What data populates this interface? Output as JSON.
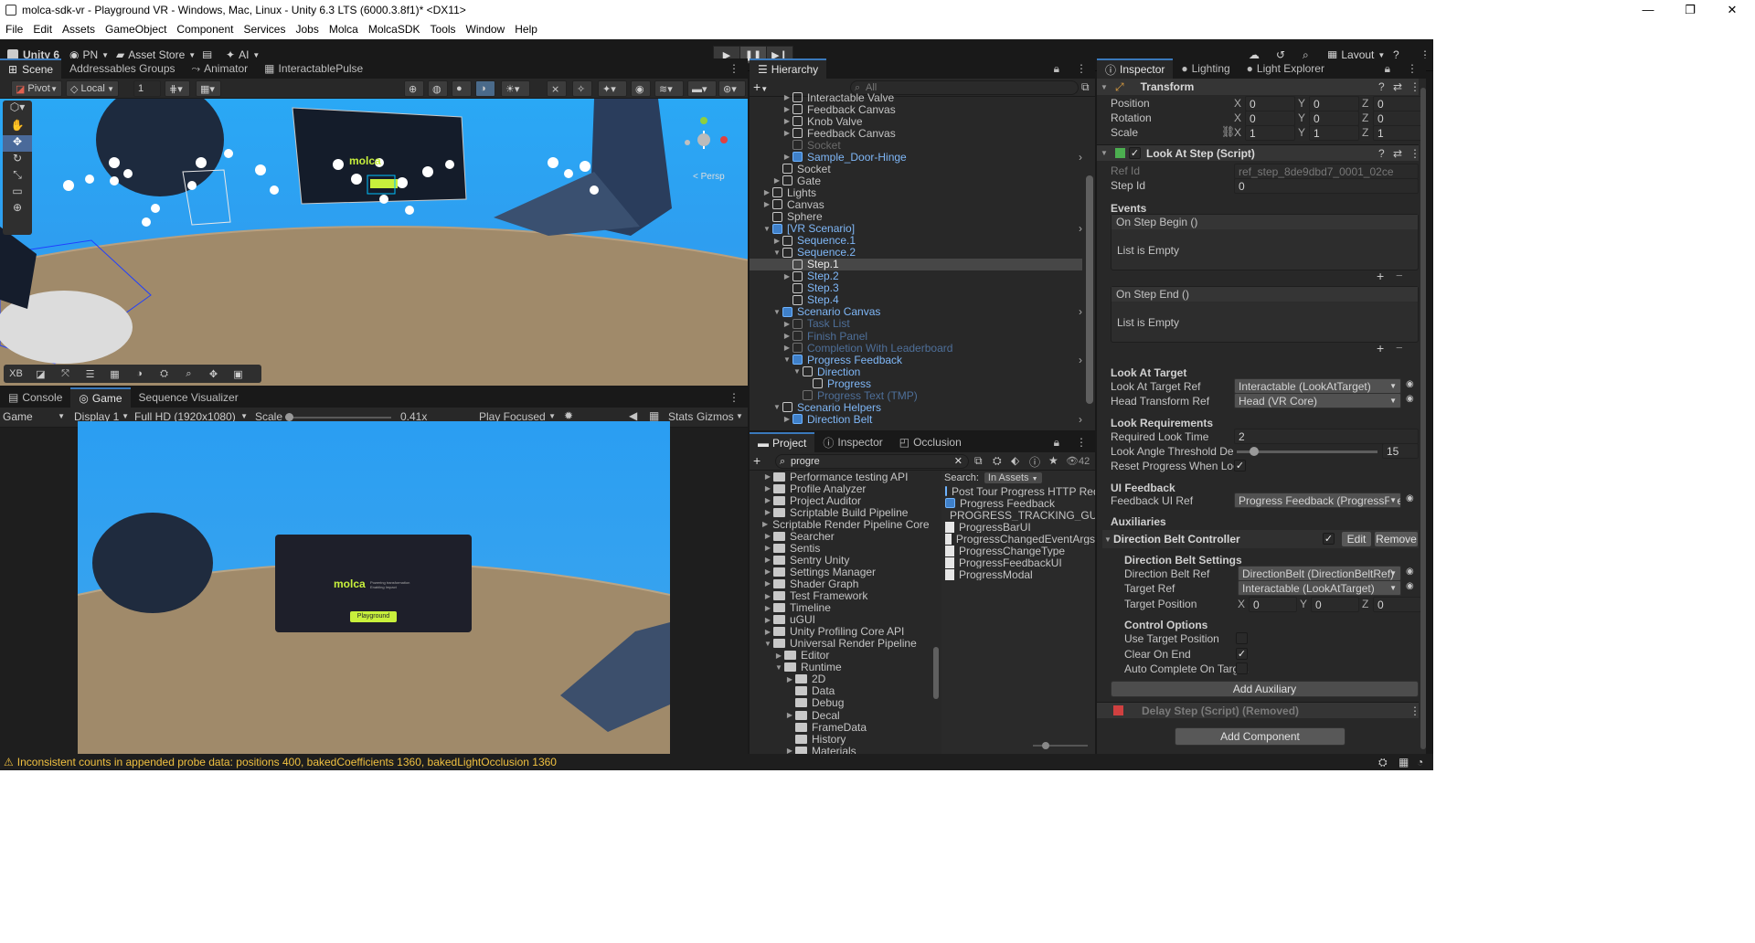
{
  "window": {
    "title": "molca-sdk-vr - Playground VR - Windows, Mac, Linux - Unity 6.3 LTS (6000.3.8f1)* <DX11>"
  },
  "menu": [
    "File",
    "Edit",
    "Assets",
    "GameObject",
    "Component",
    "Services",
    "Jobs",
    "Molca",
    "MolcaSDK",
    "Tools",
    "Window",
    "Help"
  ],
  "toolbar": {
    "unity": "Unity 6",
    "account": "PN",
    "asset_store": "Asset Store",
    "ai": "AI",
    "layout": "Layout"
  },
  "scene": {
    "tabs": [
      "Scene",
      "Addressables Groups",
      "Animator",
      "InteractablePulse"
    ],
    "pivot": "Pivot",
    "local": "Local",
    "grid": "1",
    "persp": "< Persp",
    "logo": "molca",
    "btn": "Playground",
    "overlay_label": "XB"
  },
  "game": {
    "tabs": [
      "Console",
      "Game",
      "Sequence Visualizer"
    ],
    "mode": "Game",
    "display": "Display 1",
    "resolution": "Full HD (1920x1080)",
    "scale_label": "Scale",
    "scale_value": "0.41x",
    "play_focused": "Play Focused",
    "stats": "Stats",
    "gizmos": "Gizmos",
    "card_logo": "molca",
    "card_tag": "Powering transformation Enabling Impact",
    "card_btn": "Playground"
  },
  "hierarchy": {
    "tab": "Hierarchy",
    "search_placeholder": "All",
    "items": [
      {
        "label": "Interactable Valve",
        "indent": 5,
        "arrow": "▶",
        "style": "n"
      },
      {
        "label": "Feedback Canvas",
        "indent": 5,
        "arrow": "▶",
        "style": "n"
      },
      {
        "label": "Knob Valve",
        "indent": 5,
        "arrow": "▶",
        "style": "n"
      },
      {
        "label": "Feedback Canvas",
        "indent": 5,
        "arrow": "▶",
        "style": "n"
      },
      {
        "label": "Socket",
        "indent": 5,
        "arrow": "",
        "style": "dim"
      },
      {
        "label": "Sample_Door-Hinge",
        "indent": 5,
        "arrow": "▶",
        "style": "prefab",
        "more": true
      },
      {
        "label": "Socket",
        "indent": 4,
        "arrow": "",
        "style": "n"
      },
      {
        "label": "Gate",
        "indent": 4,
        "arrow": "▶",
        "style": "n"
      },
      {
        "label": "Lights",
        "indent": 3,
        "arrow": "▶",
        "style": "n"
      },
      {
        "label": "Canvas",
        "indent": 3,
        "arrow": "▶",
        "style": "n"
      },
      {
        "label": "Sphere",
        "indent": 3,
        "arrow": "",
        "style": "n"
      },
      {
        "label": "[VR Scenario]",
        "indent": 3,
        "arrow": "▼",
        "style": "prefab",
        "more": true
      },
      {
        "label": "Sequence.1",
        "indent": 4,
        "arrow": "▶",
        "style": "blue"
      },
      {
        "label": "Sequence.2",
        "indent": 4,
        "arrow": "▼",
        "style": "blue"
      },
      {
        "label": "Step.1",
        "indent": 5,
        "arrow": "",
        "style": "sel"
      },
      {
        "label": "Step.2",
        "indent": 5,
        "arrow": "▶",
        "style": "blue"
      },
      {
        "label": "Step.3",
        "indent": 5,
        "arrow": "",
        "style": "blue"
      },
      {
        "label": "Step.4",
        "indent": 5,
        "arrow": "",
        "style": "blue"
      },
      {
        "label": "Scenario Canvas",
        "indent": 4,
        "arrow": "▼",
        "style": "prefab",
        "more": true
      },
      {
        "label": "Task List",
        "indent": 5,
        "arrow": "▶",
        "style": "dimblue"
      },
      {
        "label": "Finish Panel",
        "indent": 5,
        "arrow": "▶",
        "style": "dimblue"
      },
      {
        "label": "Completion With Leaderboard",
        "indent": 5,
        "arrow": "▶",
        "style": "dimblue"
      },
      {
        "label": "Progress Feedback",
        "indent": 5,
        "arrow": "▼",
        "style": "prefab",
        "more": true
      },
      {
        "label": "Direction",
        "indent": 6,
        "arrow": "▼",
        "style": "blue"
      },
      {
        "label": "Progress",
        "indent": 7,
        "arrow": "",
        "style": "blue"
      },
      {
        "label": "Progress Text (TMP)",
        "indent": 6,
        "arrow": "",
        "style": "dimblue"
      },
      {
        "label": "Scenario Helpers",
        "indent": 4,
        "arrow": "▼",
        "style": "blue"
      },
      {
        "label": "Direction Belt",
        "indent": 5,
        "arrow": "▶",
        "style": "prefab",
        "more": true
      }
    ]
  },
  "project": {
    "tabs": [
      "Project",
      "Inspector",
      "Occlusion"
    ],
    "search": "progre",
    "count": "42",
    "search_label": "Search:",
    "scope": "In Assets",
    "folders": [
      {
        "label": "Performance testing API",
        "indent": 1,
        "arrow": "▶"
      },
      {
        "label": "Profile Analyzer",
        "indent": 1,
        "arrow": "▶"
      },
      {
        "label": "Project Auditor",
        "indent": 1,
        "arrow": "▶"
      },
      {
        "label": "Scriptable Build Pipeline",
        "indent": 1,
        "arrow": "▶"
      },
      {
        "label": "Scriptable Render Pipeline Core",
        "indent": 1,
        "arrow": "▶"
      },
      {
        "label": "Searcher",
        "indent": 1,
        "arrow": "▶"
      },
      {
        "label": "Sentis",
        "indent": 1,
        "arrow": "▶"
      },
      {
        "label": "Sentry Unity",
        "indent": 1,
        "arrow": "▶"
      },
      {
        "label": "Settings Manager",
        "indent": 1,
        "arrow": "▶"
      },
      {
        "label": "Shader Graph",
        "indent": 1,
        "arrow": "▶"
      },
      {
        "label": "Test Framework",
        "indent": 1,
        "arrow": "▶"
      },
      {
        "label": "Timeline",
        "indent": 1,
        "arrow": "▶"
      },
      {
        "label": "uGUI",
        "indent": 1,
        "arrow": "▶"
      },
      {
        "label": "Unity Profiling Core API",
        "indent": 1,
        "arrow": "▶"
      },
      {
        "label": "Universal Render Pipeline",
        "indent": 1,
        "arrow": "▼"
      },
      {
        "label": "Editor",
        "indent": 2,
        "arrow": "▶"
      },
      {
        "label": "Runtime",
        "indent": 2,
        "arrow": "▼"
      },
      {
        "label": "2D",
        "indent": 3,
        "arrow": "▶"
      },
      {
        "label": "Data",
        "indent": 3,
        "arrow": ""
      },
      {
        "label": "Debug",
        "indent": 3,
        "arrow": ""
      },
      {
        "label": "Decal",
        "indent": 3,
        "arrow": "▶"
      },
      {
        "label": "FrameData",
        "indent": 3,
        "arrow": ""
      },
      {
        "label": "History",
        "indent": 3,
        "arrow": ""
      },
      {
        "label": "Materials",
        "indent": 3,
        "arrow": "▶"
      }
    ],
    "results": [
      {
        "label": "Post Tour Progress HTTP Request",
        "icon": "prefab"
      },
      {
        "label": "Progress Feedback",
        "icon": "prefab"
      },
      {
        "label": "PROGRESS_TRACKING_GUIDE",
        "icon": "file"
      },
      {
        "label": "ProgressBarUI",
        "icon": "file"
      },
      {
        "label": "ProgressChangedEventArgs",
        "icon": "file"
      },
      {
        "label": "ProgressChangeType",
        "icon": "file"
      },
      {
        "label": "ProgressFeedbackUI",
        "icon": "file"
      },
      {
        "label": "ProgressModal",
        "icon": "file"
      }
    ]
  },
  "inspector": {
    "tabs": [
      "Inspector",
      "Lighting",
      "Light Explorer"
    ],
    "transform": {
      "title": "Transform",
      "position": "Position",
      "rotation": "Rotation",
      "scale": "Scale",
      "pos": [
        "0",
        "0",
        "0"
      ],
      "rot": [
        "0",
        "0",
        "0"
      ],
      "scl": [
        "1",
        "1",
        "1"
      ]
    },
    "script": {
      "title": "Look At Step (Script)",
      "ref_id_label": "Ref Id",
      "ref_id": "ref_step_8de9dbd7_0001_02ce",
      "step_id_label": "Step Id",
      "step_id": "0",
      "events": "Events",
      "on_begin": "On Step Begin ()",
      "empty1": "List is Empty",
      "on_end": "On Step End ()",
      "empty2": "List is Empty",
      "look_at_target": "Look At Target",
      "lat_ref_label": "Look At Target Ref",
      "lat_ref": "Interactable (LookAtTarget)",
      "head_ref_label": "Head Transform Ref",
      "head_ref": "Head (VR Core)",
      "look_req": "Look Requirements",
      "req_time_label": "Required Look Time",
      "req_time": "2",
      "angle_label": "Look Angle Threshold Degre",
      "angle": "15",
      "reset_label": "Reset Progress When Look A",
      "ui_feedback": "UI Feedback",
      "fb_label": "Feedback UI Ref",
      "fb_ref": "Progress Feedback (ProgressFeedba",
      "aux": "Auxiliaries",
      "dbc": "Direction Belt Controller",
      "edit": "Edit",
      "remove": "Remove",
      "dbs": "Direction Belt Settings",
      "db_ref_label": "Direction Belt Ref",
      "db_ref": "DirectionBelt (DirectionBeltRef)",
      "target_ref_label": "Target Ref",
      "target_ref": "Interactable (LookAtTarget)",
      "target_pos_label": "Target Position",
      "tpos": [
        "0",
        "0",
        "0"
      ],
      "control": "Control Options",
      "use_target": "Use Target Position",
      "clear_end": "Clear On End",
      "auto_complete": "Auto Complete On Target",
      "add_aux": "Add Auxiliary"
    },
    "delay": "Delay Step (Script) (Removed)",
    "add_component": "Add Component"
  },
  "status": {
    "warning": "Inconsistent counts in appended probe data: positions 400, bakedCoefficients 1360, bakedLightOcclusion 1360"
  },
  "colors": {
    "accent": "#3a79bb",
    "sky": "#2e9ef0",
    "ground": "#a08a6a",
    "logo_green": "#c8f03c",
    "warning": "#f0c040"
  }
}
